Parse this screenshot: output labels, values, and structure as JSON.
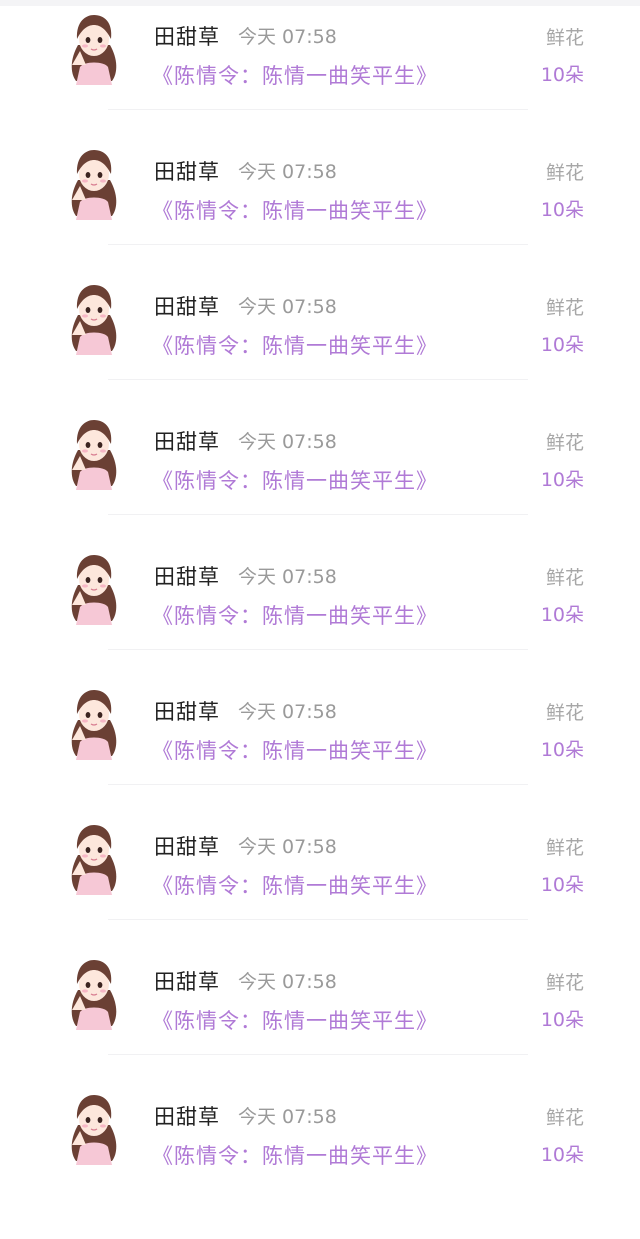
{
  "items": [
    {
      "name": "田甜草",
      "time": "今天 07:58",
      "book": "《陈情令：陈情一曲笑平生》",
      "gift": "鲜花",
      "count": "10朵"
    },
    {
      "name": "田甜草",
      "time": "今天 07:58",
      "book": "《陈情令：陈情一曲笑平生》",
      "gift": "鲜花",
      "count": "10朵"
    },
    {
      "name": "田甜草",
      "time": "今天 07:58",
      "book": "《陈情令：陈情一曲笑平生》",
      "gift": "鲜花",
      "count": "10朵"
    },
    {
      "name": "田甜草",
      "time": "今天 07:58",
      "book": "《陈情令：陈情一曲笑平生》",
      "gift": "鲜花",
      "count": "10朵"
    },
    {
      "name": "田甜草",
      "time": "今天 07:58",
      "book": "《陈情令：陈情一曲笑平生》",
      "gift": "鲜花",
      "count": "10朵"
    },
    {
      "name": "田甜草",
      "time": "今天 07:58",
      "book": "《陈情令：陈情一曲笑平生》",
      "gift": "鲜花",
      "count": "10朵"
    },
    {
      "name": "田甜草",
      "time": "今天 07:58",
      "book": "《陈情令：陈情一曲笑平生》",
      "gift": "鲜花",
      "count": "10朵"
    },
    {
      "name": "田甜草",
      "time": "今天 07:58",
      "book": "《陈情令：陈情一曲笑平生》",
      "gift": "鲜花",
      "count": "10朵"
    },
    {
      "name": "田甜草",
      "time": "今天 07:58",
      "book": "《陈情令：陈情一曲笑平生》",
      "gift": "鲜花",
      "count": "10朵"
    }
  ],
  "avatar_icon": "girl-avatar-icon",
  "colors": {
    "accent": "#b07ad6",
    "name_text": "#222222",
    "muted_text": "#9a9a9a"
  }
}
